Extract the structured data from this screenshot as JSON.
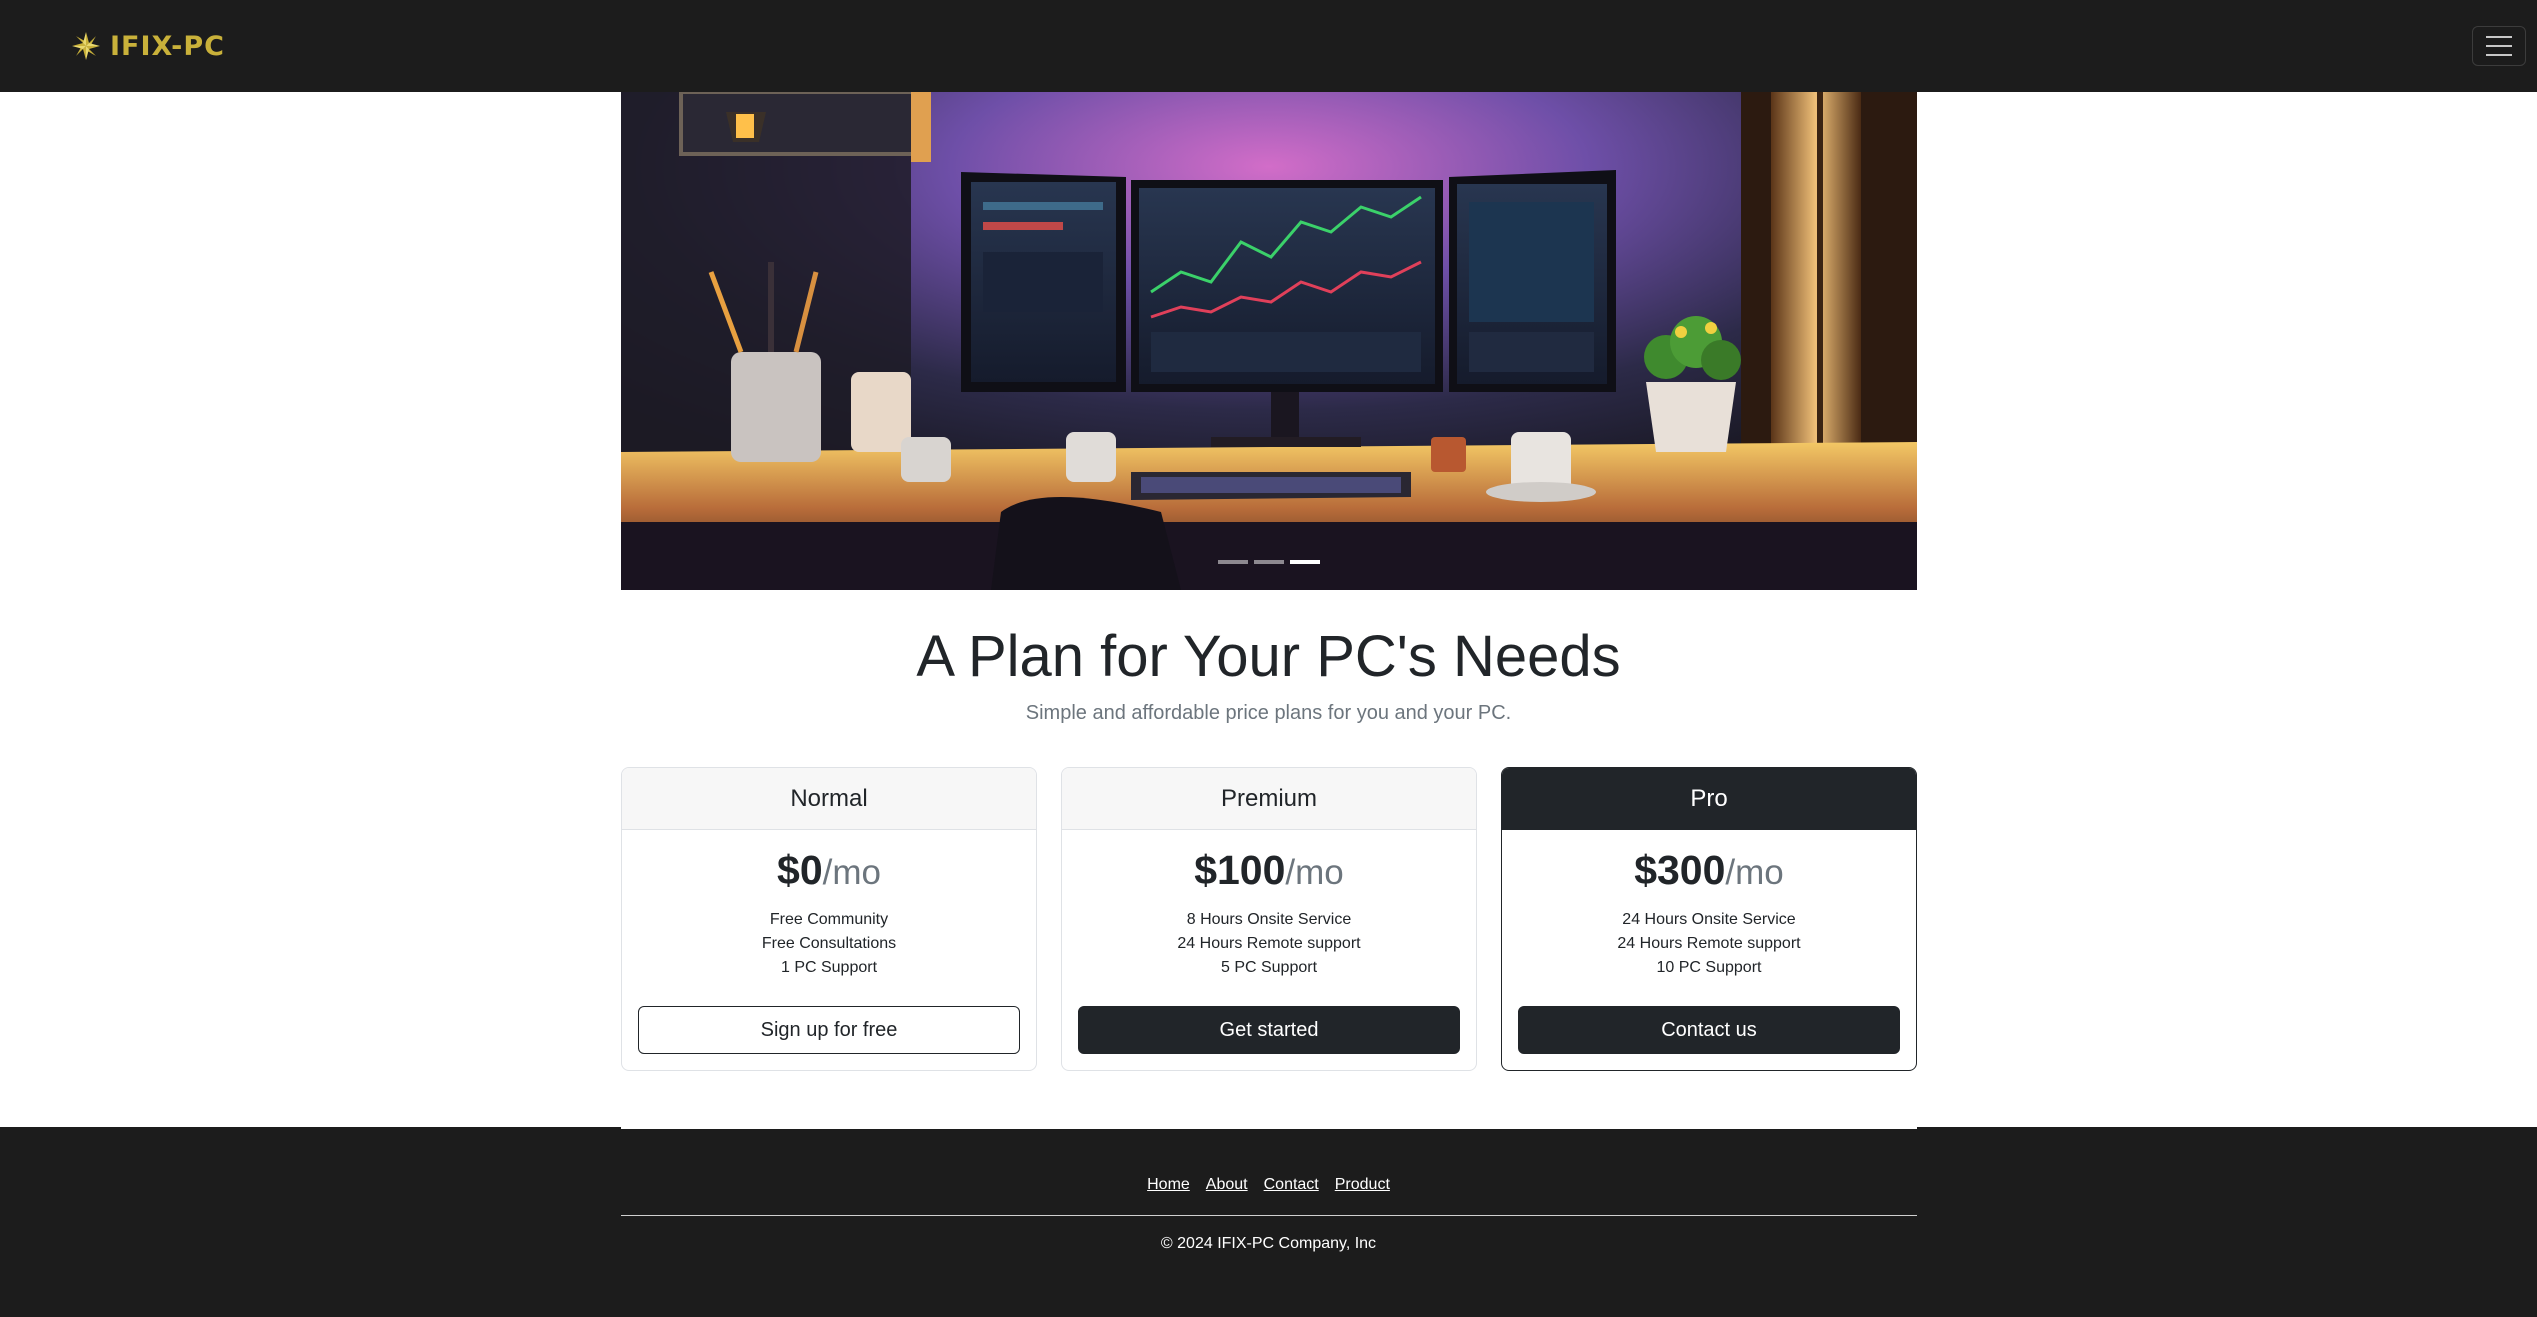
{
  "navbar": {
    "brand": "IFIX-PC",
    "brand_icon": "sparkle-logo-icon",
    "menu_icon": "hamburger-menu-icon",
    "brand_color": "#c9b13a"
  },
  "hero": {
    "image": "desk-with-monitors-illustration",
    "slide_count": 3,
    "active_slide": 3
  },
  "pricing": {
    "title": "A Plan for Your PC's Needs",
    "subtitle": "Simple and affordable price plans for you and your PC.",
    "period": "/mo",
    "plans": [
      {
        "name": "Normal",
        "price": "$0",
        "features": [
          "Free Community",
          "Free Consultations",
          "1 PC Support"
        ],
        "button": "Sign up for free"
      },
      {
        "name": "Premium",
        "price": "$100",
        "features": [
          "8 Hours Onsite Service",
          "24 Hours Remote support",
          "5 PC Support"
        ],
        "button": "Get started"
      },
      {
        "name": "Pro",
        "price": "$300",
        "features": [
          "24 Hours Onsite Service",
          "24 Hours Remote support",
          "10 PC Support"
        ],
        "button": "Contact us"
      }
    ]
  },
  "footer": {
    "links": [
      "Home",
      "About",
      "Contact",
      "Product"
    ],
    "copyright": "© 2024 IFIX-PC Company, Inc"
  }
}
